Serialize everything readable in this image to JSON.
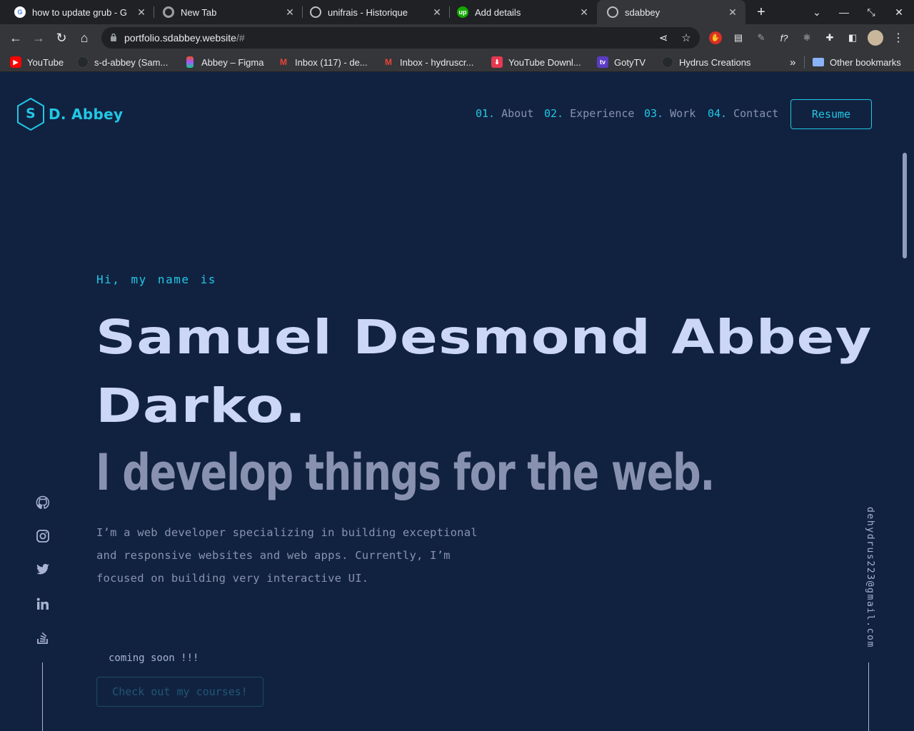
{
  "browser": {
    "tabs": [
      {
        "title": "how to update grub - G",
        "favicon": "google-icon"
      },
      {
        "title": "New Tab",
        "favicon": "chrome-icon"
      },
      {
        "title": "unifrais - Historique",
        "favicon": "globe-icon"
      },
      {
        "title": "Add details",
        "favicon": "upwork-icon"
      },
      {
        "title": "sdabbey",
        "favicon": "globe-icon"
      }
    ],
    "new_tab_symbol": "+",
    "url_host": "portfolio.sdabbey.website",
    "url_path": "/#",
    "bookmarks": [
      {
        "label": "YouTube",
        "icon": "youtube-icon"
      },
      {
        "label": "s-d-abbey (Sam...",
        "icon": "github-icon"
      },
      {
        "label": "Abbey – Figma",
        "icon": "figma-icon"
      },
      {
        "label": "Inbox (117) - de...",
        "icon": "gmail-icon"
      },
      {
        "label": "Inbox - hydruscr...",
        "icon": "gmail-icon"
      },
      {
        "label": "YouTube Downl...",
        "icon": "download-icon"
      },
      {
        "label": "GotyTV",
        "icon": "gotytv-icon"
      },
      {
        "label": "Hydrus Creations",
        "icon": "github-icon"
      }
    ],
    "overflow_symbol": "»",
    "other_bookmarks": "Other bookmarks"
  },
  "site": {
    "logo_letter": "S",
    "logo_text": "D. Abbey",
    "nav": [
      {
        "num": "01.",
        "label": "About"
      },
      {
        "num": "02.",
        "label": "Experience"
      },
      {
        "num": "03.",
        "label": "Work"
      },
      {
        "num": "04.",
        "label": "Contact"
      }
    ],
    "resume_label": "Resume",
    "greeting": "Hi, my name is",
    "name_line1": "Samuel Desmond Abbey",
    "name_line2": "Darko.",
    "tagline": "I develop things for the web.",
    "description": "I’m a web developer specializing in building exceptional and responsive websites and web apps. Currently, I’m focused on building very interactive UI.",
    "coming_soon": "coming soon !!!",
    "courses_label": "Check out my courses!",
    "email": "dehydrus223@gmail.com",
    "socials": [
      "github-icon",
      "instagram-icon",
      "twitter-icon",
      "linkedin-icon",
      "stackoverflow-icon"
    ]
  },
  "colors": {
    "background": "#112240",
    "accent": "#22c7e6",
    "heading": "#ccd6f6",
    "body_text": "#8892b0"
  }
}
